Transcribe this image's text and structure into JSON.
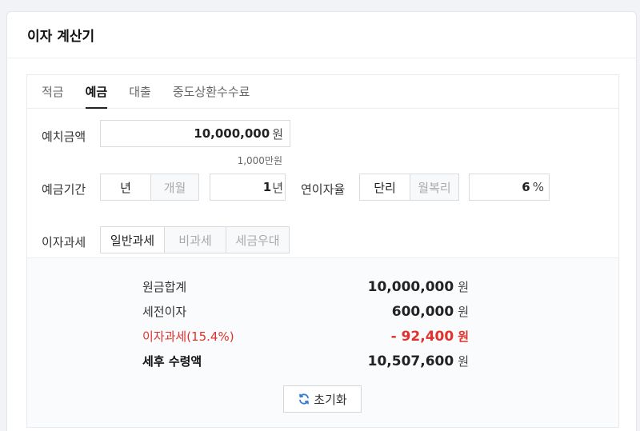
{
  "title": "이자 계산기",
  "tabs": [
    {
      "label": "적금"
    },
    {
      "label": "예금"
    },
    {
      "label": "대출"
    },
    {
      "label": "중도상환수수료"
    }
  ],
  "active_tab": "예금",
  "deposit": {
    "label": "예치금액",
    "value": "10,000,000",
    "unit": "원",
    "hint": "1,000만원"
  },
  "period": {
    "label": "예금기간",
    "options": [
      "년",
      "개월"
    ],
    "selected": "년",
    "value": "1",
    "unit": "년"
  },
  "rate": {
    "label": "연이자율",
    "options": [
      "단리",
      "월복리"
    ],
    "selected": "단리",
    "value": "6",
    "unit": "%"
  },
  "tax": {
    "label": "이자과세",
    "options": [
      "일반과세",
      "비과세",
      "세금우대"
    ],
    "selected": "일반과세"
  },
  "results": [
    {
      "label": "원금합계",
      "value": "10,000,000",
      "unit": "원"
    },
    {
      "label": "세전이자",
      "value": "600,000",
      "unit": "원"
    },
    {
      "label": "이자과세(15.4%)",
      "value": "- 92,400",
      "unit": "원"
    },
    {
      "label": "세후 수령액",
      "value": "10,507,600",
      "unit": "원"
    }
  ],
  "reset_label": "초기화",
  "colors": {
    "accent_red": "#e2312d"
  },
  "icons": {
    "reset": "refresh-icon"
  }
}
